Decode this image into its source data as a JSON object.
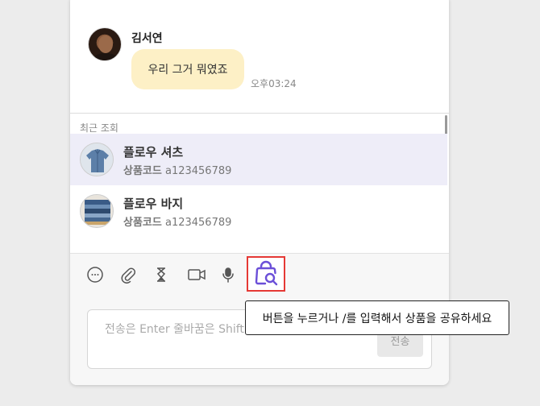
{
  "chat": {
    "sender_name": "김서연",
    "message": "우리 그거 뭐였죠",
    "time": "오후03:24"
  },
  "recent": {
    "title": "최근 조회",
    "items": [
      {
        "name": "플로우 셔츠",
        "code_label": "상품코드",
        "code": "a123456789"
      },
      {
        "name": "플로우 바지",
        "code_label": "상품코드",
        "code": "a123456789"
      }
    ]
  },
  "toolbar": {
    "icons": [
      "emoji-icon",
      "attachment-icon",
      "hourglass-icon",
      "video-icon",
      "microphone-icon",
      "product-search-icon"
    ]
  },
  "composer": {
    "placeholder": "전송은 Enter 줄바꿈은 Shift",
    "send_label": "전송"
  },
  "tooltip": {
    "text": "버튼을 누르거나 /를 입력해서 상품을 공유하세요"
  },
  "colors": {
    "bubble": "#fdf0c6",
    "active_item": "#eeedf8",
    "accent": "#6b4fd8",
    "highlight_border": "#e53935"
  }
}
